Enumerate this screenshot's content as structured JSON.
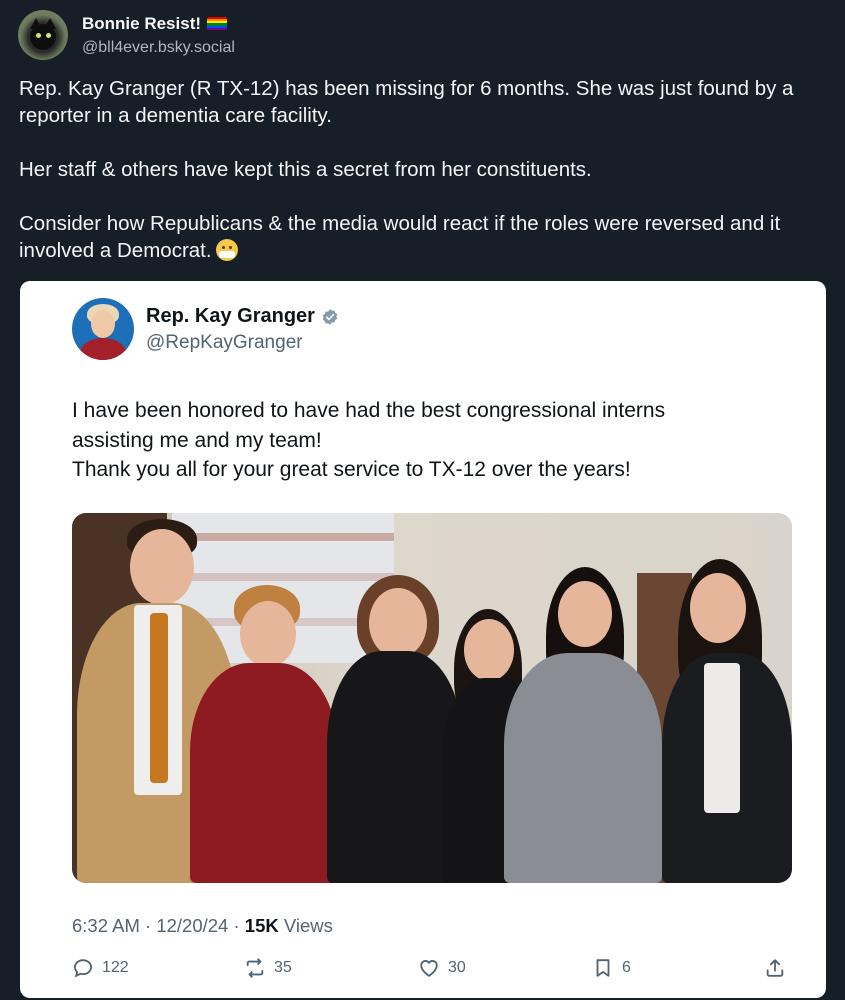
{
  "post": {
    "author": {
      "display_name": "Bonnie Resist!",
      "handle": "@bll4ever.bsky.social",
      "flag_icon": "rainbow-flag-icon"
    },
    "paragraphs": [
      "Rep. Kay Granger (R TX-12) has been missing for 6 months. She was just found by a reporter in a dementia care facility.",
      "Her staff & others have kept this a secret from her constituents.",
      "Consider how Republicans & the media would react if the roles were reversed and it involved a Democrat."
    ],
    "trailing_emoji": "face-with-medical-mask-icon"
  },
  "embedded_tweet": {
    "display_name": "Rep. Kay Granger",
    "verified_icon": "verified-badge-icon",
    "handle": "@RepKayGranger",
    "lines": [
      "I have been honored to have had the best congressional interns",
      "assisting me and my team!",
      "Thank you all for your great service to TX-12 over the years!"
    ],
    "timestamp": "6:32 AM · 12/20/24 · ",
    "views_count": "15K",
    "views_label": " Views",
    "actions": {
      "replies": "122",
      "reposts": "35",
      "likes": "30",
      "bookmarks": "6"
    }
  }
}
